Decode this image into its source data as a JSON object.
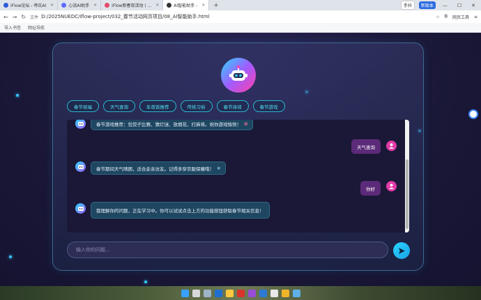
{
  "browser": {
    "tabs": [
      {
        "label": "iFlow论坛 - 帝氏AI",
        "color": "#2b5bd7",
        "active": false
      },
      {
        "label": "心流AI助手",
        "color": "#5a6cff",
        "active": false
      },
      {
        "label": "iFlow新春双活动丨...",
        "color": "#e24a6a",
        "active": false
      },
      {
        "label": "AI智能助手 -",
        "color": "#333333",
        "active": true
      }
    ],
    "new_tab": "+",
    "right_buttons": [
      "手抖",
      "新版本"
    ],
    "url_prefix": "文件",
    "url": "D:/2025NUEDC/iflow-project/032_春节活动网页项目/08_AI智能助手.html",
    "right_tools": [
      "网页工具"
    ],
    "bookmarks": [
      "导入书签",
      "网址导航"
    ]
  },
  "assistant": {
    "features": [
      "春节祝福",
      "天气查询",
      "年夜饭推荐",
      "传统习俗",
      "春节诗词",
      "春节游戏"
    ],
    "messages": [
      {
        "role": "bot",
        "text": "春节游戏推荐：包饺子比赛、猜灯谜、放烟花、打麻将。祝你游戏愉快！"
      },
      {
        "role": "user",
        "text": "天气查询"
      },
      {
        "role": "bot",
        "text": "春节期间天气晴朗，适合走亲访友。记得多穿衣服保暖哦！"
      },
      {
        "role": "user",
        "text": "你好"
      },
      {
        "role": "bot",
        "text": "我理解你的问题，正在学习中。你可以试试点击上方的功能按钮获取春节相关信息！"
      }
    ],
    "input_placeholder": "输入你的问题..."
  },
  "icons": {
    "bot": "robot-icon",
    "user": "user-icon",
    "send": "send-icon"
  },
  "colors": {
    "accent": "#2ad6ff",
    "user_bubble": "#5b2a78",
    "bot_bubble": "#1f4660"
  }
}
